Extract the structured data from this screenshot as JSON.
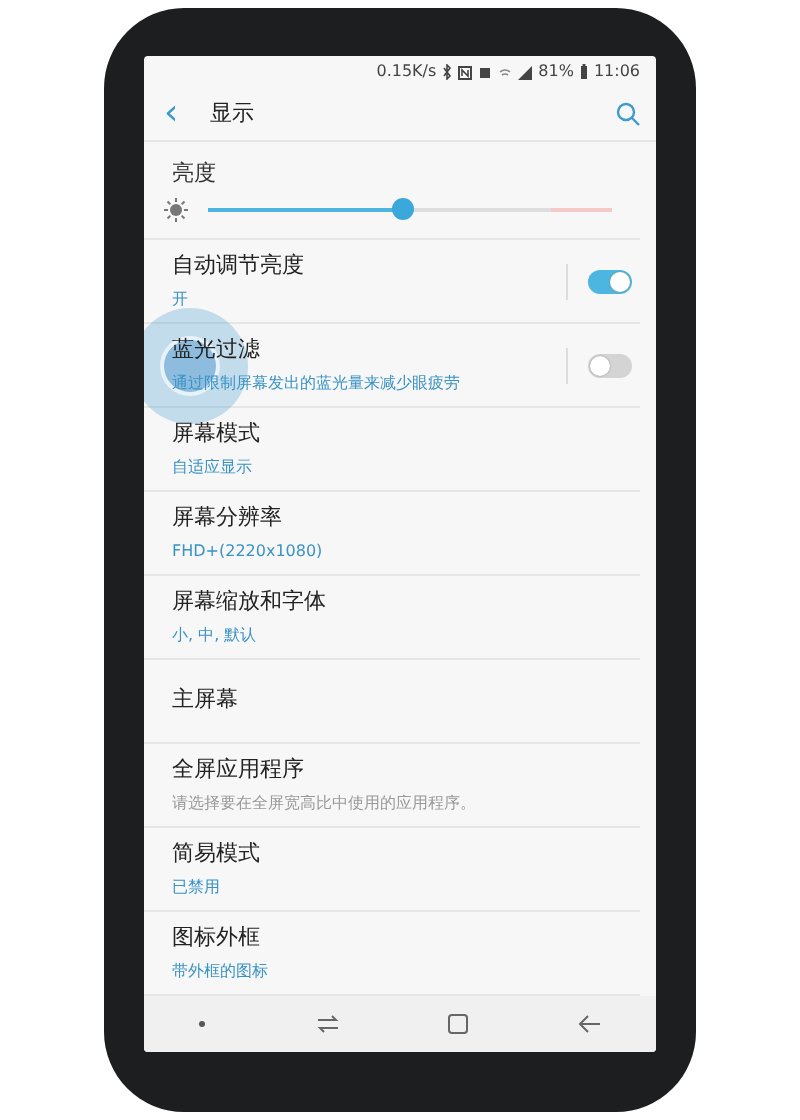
{
  "status_bar": {
    "speed": "0.15K/s",
    "battery": "81%",
    "time": "11:06"
  },
  "header": {
    "back": "‹",
    "title": "显示"
  },
  "brightness": {
    "title": "亮度",
    "level": 0.48
  },
  "items": [
    {
      "kind": "switch",
      "title": "自动调节亮度",
      "subtitle": "开",
      "on": true
    },
    {
      "kind": "switch",
      "title": "蓝光过滤",
      "subtitle": "通过限制屏幕发出的蓝光量来减少眼疲劳",
      "on": false,
      "touched": true
    },
    {
      "kind": "value",
      "title": "屏幕模式",
      "subtitle": "自适应显示"
    },
    {
      "kind": "value",
      "title": "屏幕分辨率",
      "subtitle": "FHD+(2220x1080)"
    },
    {
      "kind": "value",
      "title": "屏幕缩放和字体",
      "subtitle": "小, 中, 默认"
    },
    {
      "kind": "plain",
      "title": "主屏幕"
    },
    {
      "kind": "hint",
      "title": "全屏应用程序",
      "subtitle": "请选择要在全屏宽高比中使用的应用程序。"
    },
    {
      "kind": "value",
      "title": "简易模式",
      "subtitle": "已禁用"
    },
    {
      "kind": "value",
      "title": "图标外框",
      "subtitle": "带外框的图标"
    }
  ]
}
